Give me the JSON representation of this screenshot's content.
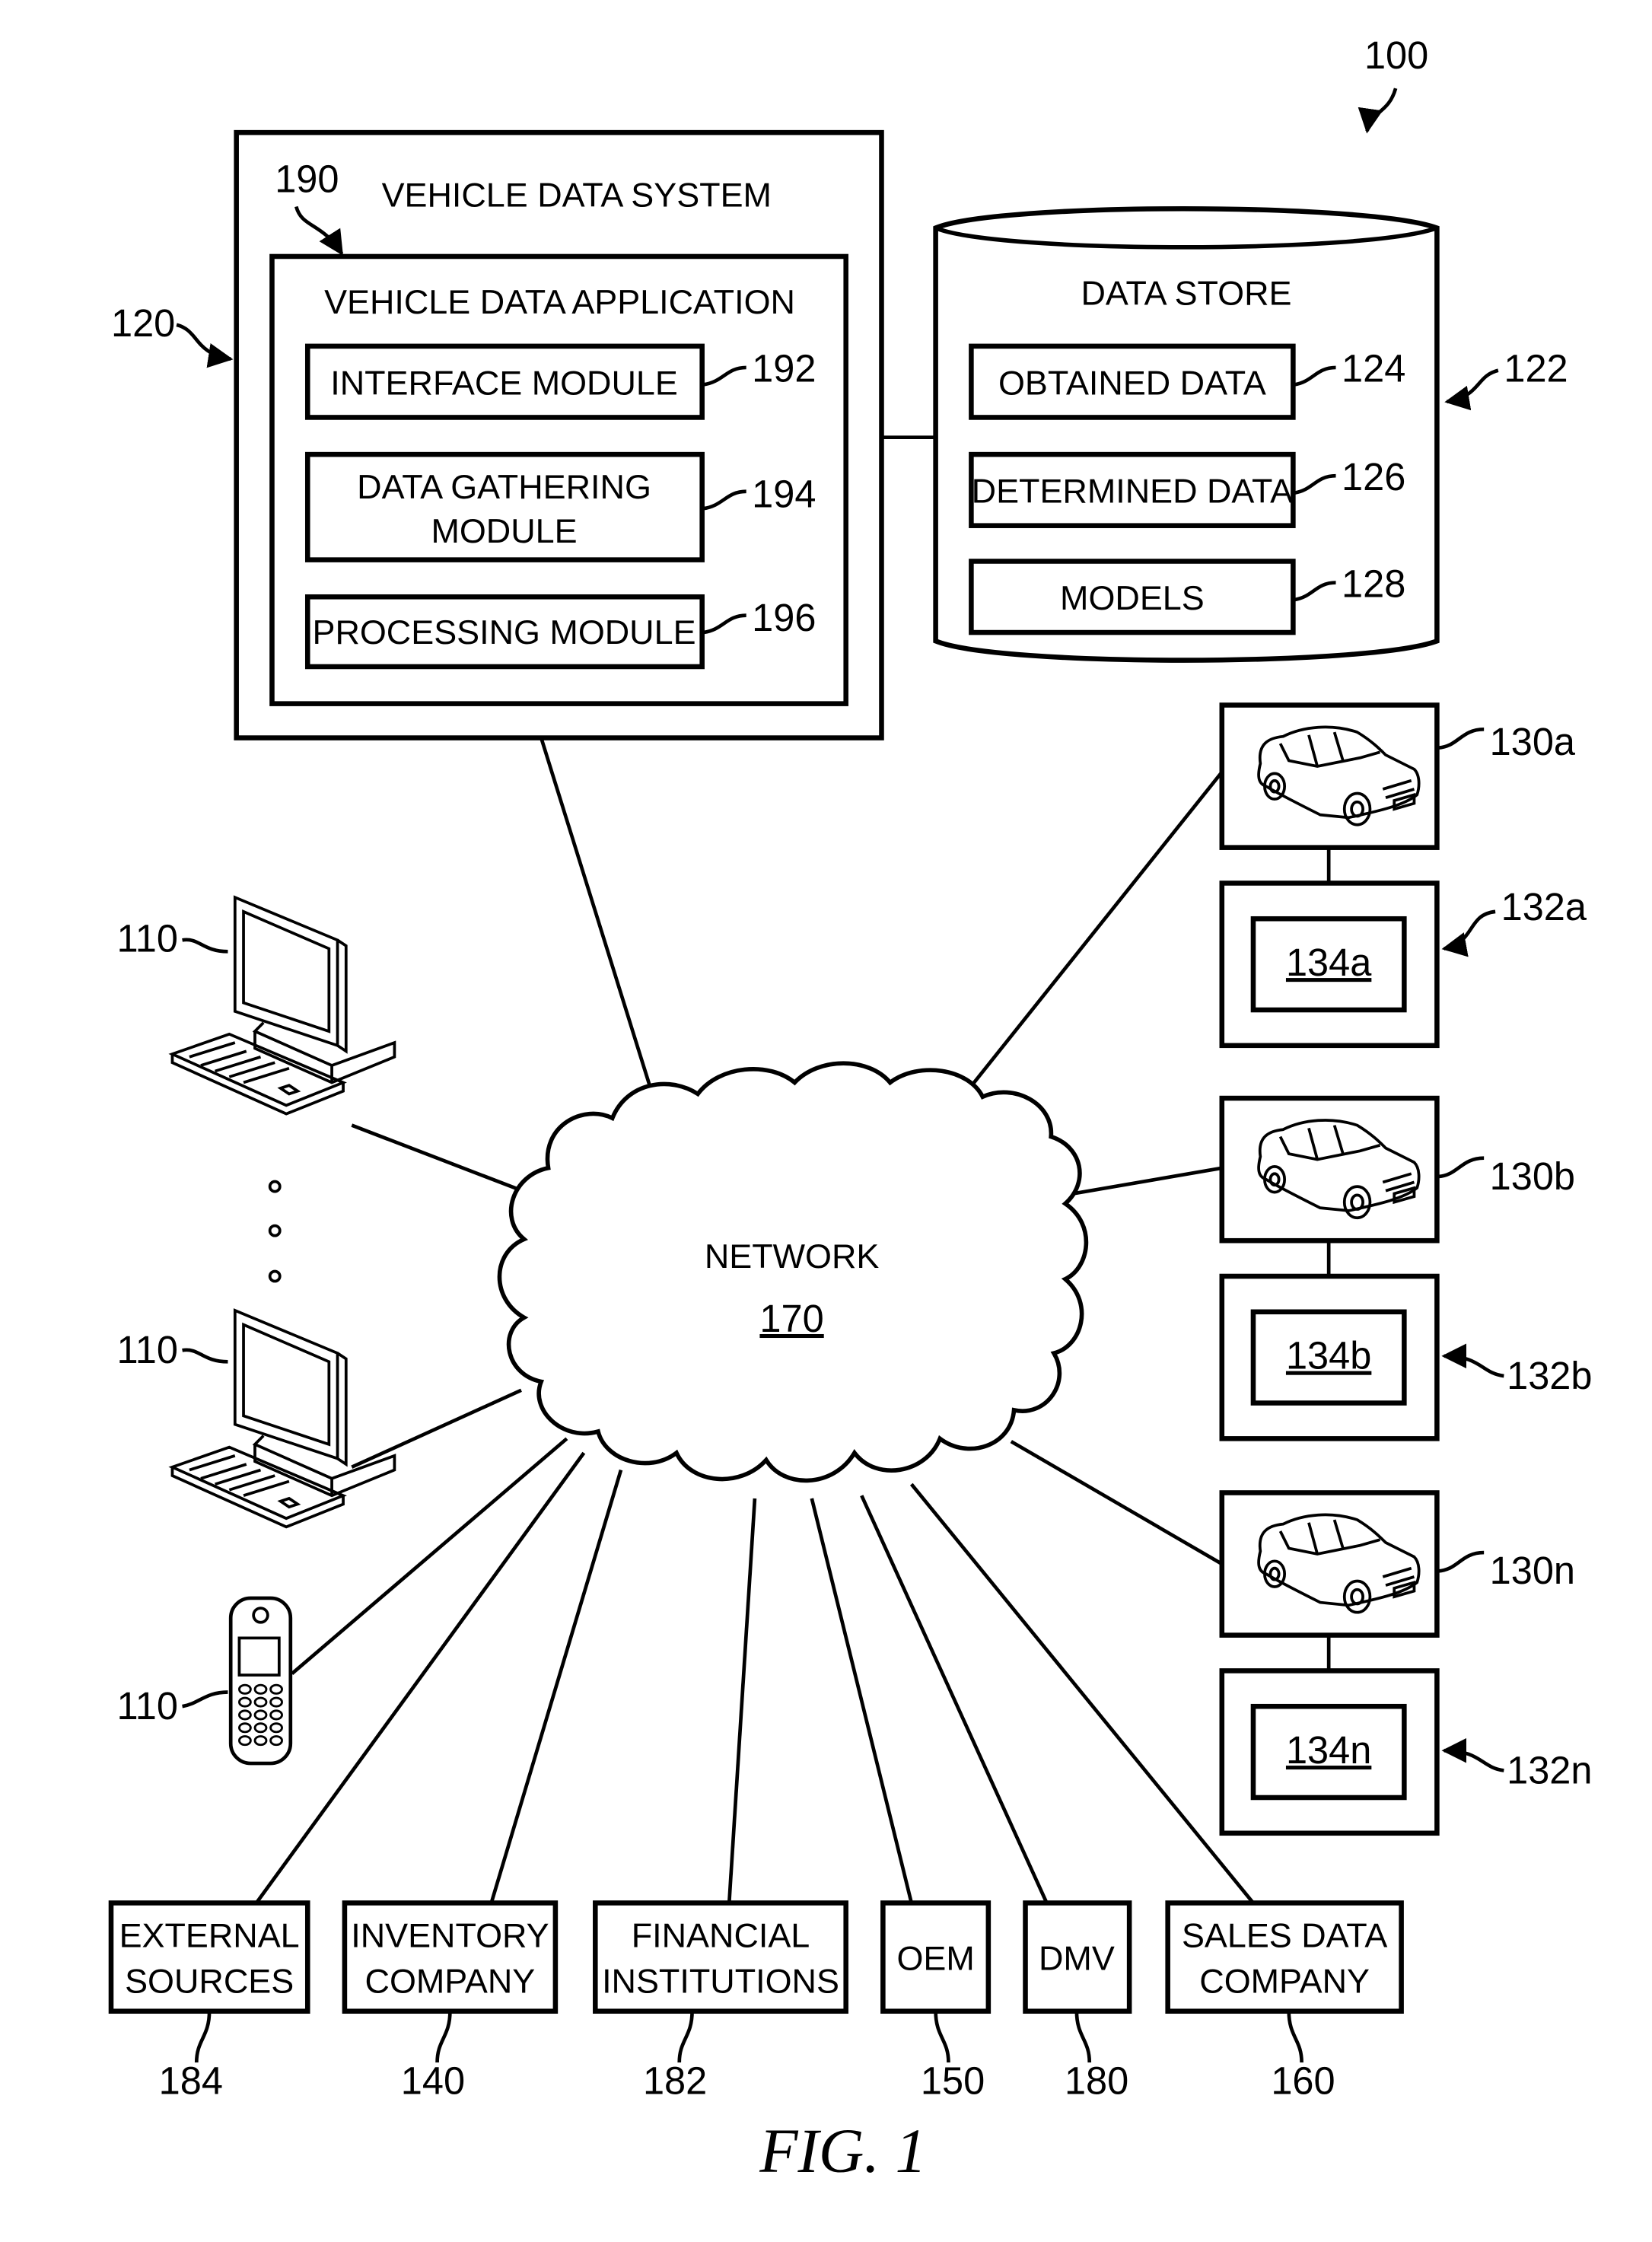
{
  "figure": {
    "caption": "FIG. 1",
    "ref": "100"
  },
  "vehicle_data_system": {
    "title": "VEHICLE DATA SYSTEM",
    "ref": "120",
    "application": {
      "title": "VEHICLE DATA APPLICATION",
      "ref": "190",
      "modules": [
        {
          "line1": "INTERFACE MODULE",
          "line2": "",
          "ref": "192"
        },
        {
          "line1": "DATA GATHERING",
          "line2": "MODULE",
          "ref": "194"
        },
        {
          "line1": "PROCESSING MODULE",
          "line2": "",
          "ref": "196"
        }
      ]
    }
  },
  "data_store": {
    "title": "DATA STORE",
    "ref": "122",
    "items": [
      {
        "label": "OBTAINED DATA",
        "ref": "124"
      },
      {
        "label": "DETERMINED DATA",
        "ref": "126"
      },
      {
        "label": "MODELS",
        "ref": "128"
      }
    ]
  },
  "network": {
    "label": "NETWORK",
    "ref": "170"
  },
  "clients": [
    {
      "type": "desktop-computer",
      "ref": "110"
    },
    {
      "type": "desktop-computer",
      "ref": "110"
    },
    {
      "type": "mobile-phone",
      "ref": "110"
    }
  ],
  "vehicles": [
    {
      "vehicle_ref": "130a",
      "device_ref": "132a",
      "inner_ref": "134a"
    },
    {
      "vehicle_ref": "130b",
      "device_ref": "132b",
      "inner_ref": "134b"
    },
    {
      "vehicle_ref": "130n",
      "device_ref": "132n",
      "inner_ref": "134n"
    }
  ],
  "entities": [
    {
      "line1": "EXTERNAL",
      "line2": "SOURCES",
      "ref": "184"
    },
    {
      "line1": "INVENTORY",
      "line2": "COMPANY",
      "ref": "140"
    },
    {
      "line1": "FINANCIAL",
      "line2": "INSTITUTIONS",
      "ref": "182"
    },
    {
      "line1": "OEM",
      "line2": "",
      "ref": "150"
    },
    {
      "line1": "DMV",
      "line2": "",
      "ref": "180"
    },
    {
      "line1": "SALES DATA",
      "line2": "COMPANY",
      "ref": "160"
    }
  ]
}
